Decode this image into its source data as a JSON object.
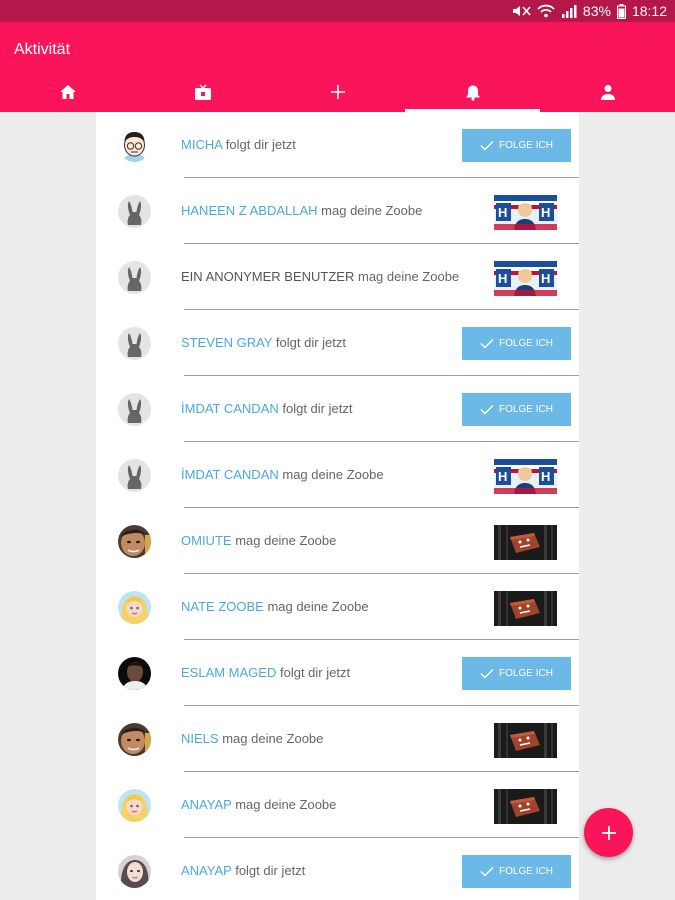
{
  "status_bar": {
    "battery": "83%",
    "time": "18:12"
  },
  "app_bar": {
    "title": "Aktivität"
  },
  "tabs": [
    {
      "icon": "home-icon"
    },
    {
      "icon": "tv-icon"
    },
    {
      "icon": "plus-icon"
    },
    {
      "icon": "bell-icon",
      "active": true
    },
    {
      "icon": "person-icon"
    }
  ],
  "activity": {
    "items": [
      {
        "name": "MICHA",
        "action": "folgt dir jetzt",
        "avatar": "cartoon-avatar",
        "type": "follow",
        "button": "FOLGE ICH"
      },
      {
        "name": "HANEEN Z ABDALLAH",
        "action": "mag deine Zoobe",
        "avatar": "bunny-avatar",
        "type": "like"
      },
      {
        "name": "EIN ANONYMER BENUTZER",
        "action": "mag deine Zoobe",
        "avatar": "bunny-avatar",
        "type": "like"
      },
      {
        "name": "STEVEN GRAY",
        "action": "folgt dir jetzt",
        "avatar": "bunny-avatar",
        "type": "follow",
        "button": "FOLGE ICH"
      },
      {
        "name": "İMDAT CANDAN",
        "action": "folgt dir jetzt",
        "avatar": "bunny-avatar",
        "type": "follow",
        "button": "FOLGE ICH"
      },
      {
        "name": "İMDAT CANDAN",
        "action": "mag deine Zoobe",
        "avatar": "bunny-avatar",
        "type": "like"
      },
      {
        "name": "OMIUTE",
        "action": "mag deine Zoobe",
        "avatar": "photo-avatar",
        "type": "like"
      },
      {
        "name": "NATE ZOOBE",
        "action": "mag deine Zoobe",
        "avatar": "blonde-avatar",
        "type": "like"
      },
      {
        "name": "ESLAM MAGED",
        "action": "folgt dir jetzt",
        "avatar": "dark-photo-avatar",
        "type": "follow",
        "button": "FOLGE ICH"
      },
      {
        "name": "NIELS",
        "action": "mag deine Zoobe",
        "avatar": "photo-avatar",
        "type": "like"
      },
      {
        "name": "ANAYAP",
        "action": "mag deine Zoobe",
        "avatar": "blonde-avatar",
        "type": "like"
      },
      {
        "name": "ANAYAP",
        "action": "folgt dir jetzt",
        "avatar": "girl-avatar",
        "type": "follow",
        "button": "FOLGE ICH"
      }
    ]
  },
  "colors": {
    "primary": "#fa1459",
    "status_bar": "#b4184a",
    "link": "#4aa9dc",
    "follow_button": "#6cb8e7"
  }
}
